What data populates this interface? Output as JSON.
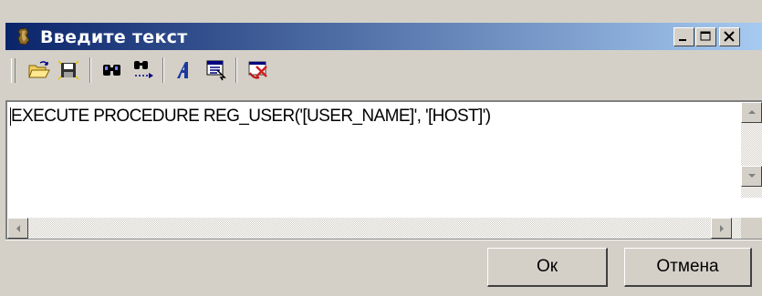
{
  "window": {
    "title": "Введите текст",
    "controls": [
      "minimize-icon",
      "maximize-icon",
      "close-icon"
    ]
  },
  "toolbar": {
    "icons": [
      "open-file-icon",
      "save-file-icon",
      "find-icon",
      "find-next-icon",
      "font-icon",
      "select-all-icon",
      "clear-icon"
    ]
  },
  "editor": {
    "text": "EXECUTE PROCEDURE REG_USER('[USER_NAME]', '[HOST]')"
  },
  "buttons": {
    "ok_label": "Ок",
    "cancel_label": "Отмена"
  },
  "colors": {
    "title_active": "#0a246a",
    "title_gradient_end": "#a6caf0",
    "face": "#d4d0c8"
  }
}
